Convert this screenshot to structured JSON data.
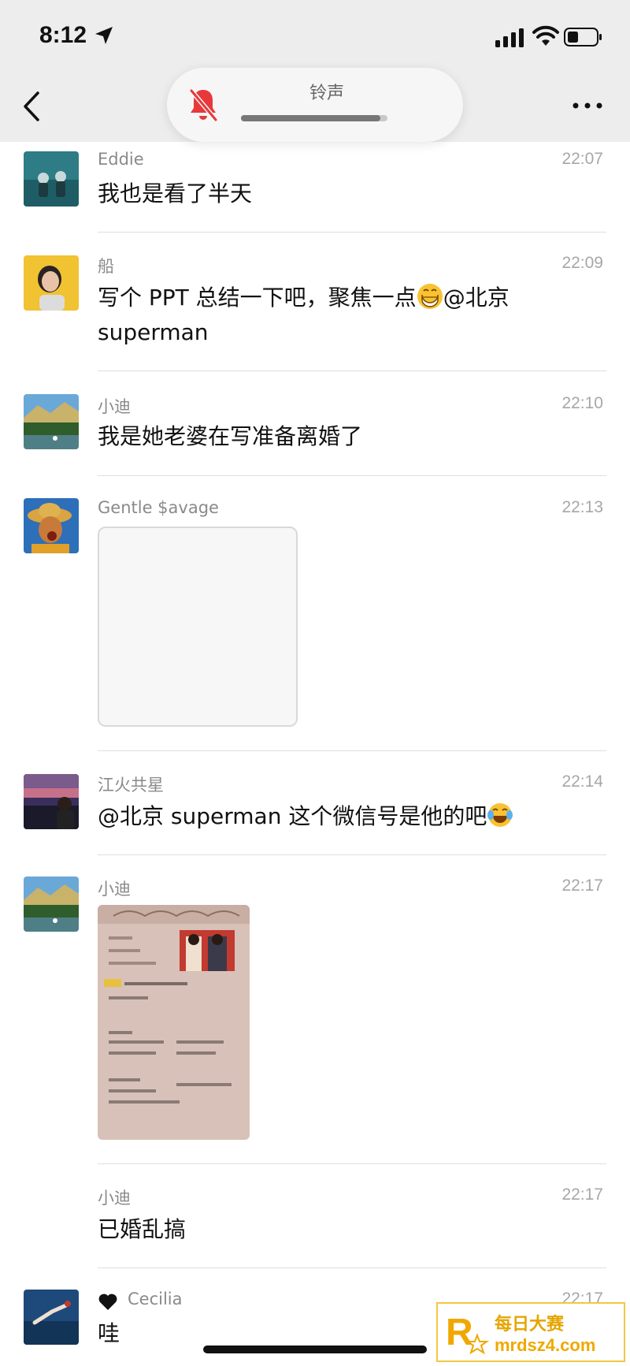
{
  "status_bar": {
    "time": "8:12"
  },
  "header": {
    "ringtone_label": "铃声",
    "ringtone_volume": 0.95,
    "mute_color": "#e8393a"
  },
  "messages": [
    {
      "sender": "Eddie",
      "time": "22:07",
      "text": "我也是看了半天"
    },
    {
      "sender": "船",
      "time": "22:09",
      "text_before_emoji": "写个 PPT 总结一下吧，聚焦一点",
      "emoji": "grinning-face-emoji",
      "text_after_emoji": "@北京",
      "text_line2": "superman"
    },
    {
      "sender": "小迪",
      "time": "22:10",
      "text": "我是她老婆在写准备离婚了"
    },
    {
      "sender": "Gentle $avage",
      "time": "22:13",
      "image": "blank-image"
    },
    {
      "sender": "江火共星",
      "time": "22:14",
      "text_before_emoji": "@北京 superman 这个微信号是他的吧",
      "emoji": "tears-of-joy-emoji"
    },
    {
      "sender": "小迪",
      "time": "22:17",
      "image": "document-photo"
    },
    {
      "sender": "小迪",
      "time": "22:17",
      "text": "已婚乱搞"
    },
    {
      "sender": "Cecilia",
      "sender_prefix_icon": "black-heart-icon",
      "time": "22:17",
      "text": "哇"
    }
  ],
  "watermark": {
    "title": "每日大赛",
    "domain": "mrdsz4.com"
  }
}
